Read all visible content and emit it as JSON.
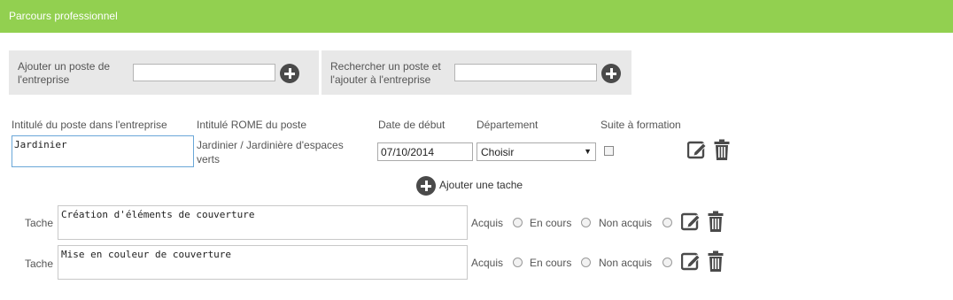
{
  "header": {
    "title": "Parcours professionnel"
  },
  "add_post_panel": {
    "label": "Ajouter un poste de l'entreprise",
    "value": ""
  },
  "search_post_panel": {
    "label": "Rechercher un poste et l'ajouter à l'entreprise",
    "value": ""
  },
  "columns": {
    "job_title": "Intitulé du poste dans l'entreprise",
    "rome_title": "Intitulé ROME du poste",
    "start_date": "Date de début",
    "department": "Département",
    "training": "Suite à formation"
  },
  "job": {
    "title_value": "Jardinier",
    "rome_value": "Jardinier / Jardinière d'espaces verts",
    "start_date_value": "07/10/2014",
    "department_value": "Choisir",
    "training_checked": false
  },
  "add_task": {
    "label": "Ajouter une tache"
  },
  "tasks": [
    {
      "label": "Tache",
      "value": "Création d'éléments de couverture",
      "status_labels": [
        "Acquis",
        "En cours",
        "Non acquis"
      ]
    },
    {
      "label": "Tache",
      "value": "Mise en couleur de couverture",
      "status_labels": [
        "Acquis",
        "En cours",
        "Non acquis"
      ]
    }
  ],
  "icons": {
    "add": "plus-circle-icon",
    "edit": "edit-icon",
    "delete": "trash-icon"
  },
  "colors": {
    "header_bg": "#92d050",
    "panel_bg": "#e8e8e8",
    "icon_fill": "#4a4a4a"
  }
}
